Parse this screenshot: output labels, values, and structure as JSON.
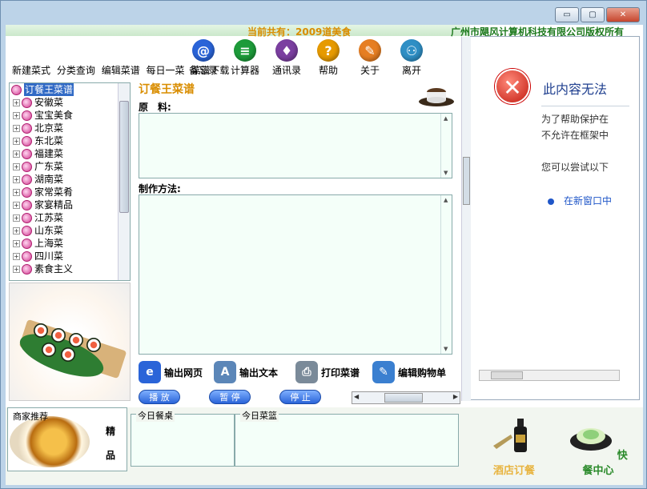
{
  "window": {
    "min_label": "▭",
    "max_label": "▢",
    "close_label": "✕"
  },
  "banner": {
    "count_text": "当前共有：2009道美食",
    "corp_text": "广州市飓风计算机科技有限公司版权所有"
  },
  "menu": [
    "新建菜式",
    "分类查询",
    "编辑菜谱",
    "每日一菜",
    "菜谱下载"
  ],
  "tools": [
    {
      "label": "备忘录",
      "icon": "at-icon",
      "glyph": "@",
      "color": "#2a64d8"
    },
    {
      "label": "计算器",
      "icon": "calculator-icon",
      "glyph": "≡",
      "color": "#1d9b3a"
    },
    {
      "label": "通讯录",
      "icon": "contacts-icon",
      "glyph": "♦",
      "color": "#7b3fa0"
    },
    {
      "label": "帮助",
      "icon": "help-icon",
      "glyph": "?",
      "color": "#e69a00"
    },
    {
      "label": "关于",
      "icon": "about-icon",
      "glyph": "✎",
      "color": "#e67e22"
    },
    {
      "label": "离开",
      "icon": "exit-icon",
      "glyph": "⚇",
      "color": "#2f8fc5"
    }
  ],
  "tree": {
    "root": "订餐王菜谱",
    "items": [
      "安徽菜",
      "宝宝美食",
      "北京菜",
      "东北菜",
      "福建菜",
      "广东菜",
      "湖南菜",
      "家常菜肴",
      "家宴精品",
      "江苏菜",
      "山东菜",
      "上海菜",
      "四川菜",
      "素食主义"
    ]
  },
  "main": {
    "title": "订餐王菜谱",
    "ingredients_label": "原　料:",
    "method_label": "制作方法:"
  },
  "actions": [
    {
      "label": "输出网页",
      "icon": "web-export-icon",
      "color": "#2a64d8",
      "glyph": "e"
    },
    {
      "label": "输出文本",
      "icon": "text-export-icon",
      "color": "#5b86b8",
      "glyph": "A"
    },
    {
      "label": "打印菜谱",
      "icon": "printer-icon",
      "color": "#7a8a99",
      "glyph": "⎙"
    },
    {
      "label": "编辑购物单",
      "icon": "shopping-edit-icon",
      "color": "#3a7fd0",
      "glyph": "✎"
    }
  ],
  "playback": {
    "play": "播 放",
    "pause": "暂 停",
    "stop": "停 止"
  },
  "bottom": {
    "shop_label": "商家推荐",
    "shop_v1": "精",
    "shop_v2": "品",
    "today_table": "今日餐桌",
    "today_dish": "今日菜篮",
    "brand_hotel": "酒店订餐",
    "brand_fast": "快餐中心"
  },
  "rightpane": {
    "title": "此内容无法",
    "line1": "为了帮助保护在",
    "line2": "不允许在框架中",
    "line3": "您可以尝试以下",
    "link": "在新窗口中"
  }
}
